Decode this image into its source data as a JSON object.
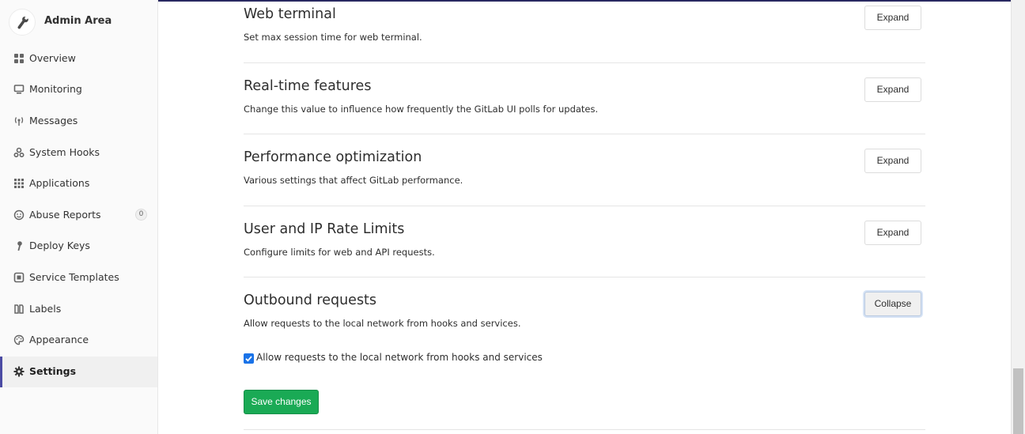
{
  "colors": {
    "accent": "#4b4ba3",
    "success": "#1aaa55",
    "topline": "#292961"
  },
  "sidebar": {
    "title": "Admin Area",
    "title_icon": "wrench-icon",
    "items": [
      {
        "label": "Overview",
        "icon": "grid-icon"
      },
      {
        "label": "Monitoring",
        "icon": "monitor-icon"
      },
      {
        "label": "Messages",
        "icon": "broadcast-icon"
      },
      {
        "label": "System Hooks",
        "icon": "hook-icon"
      },
      {
        "label": "Applications",
        "icon": "apps-grid-icon"
      },
      {
        "label": "Abuse Reports",
        "icon": "smiley-icon",
        "badge": "0"
      },
      {
        "label": "Deploy Keys",
        "icon": "key-icon"
      },
      {
        "label": "Service Templates",
        "icon": "template-icon"
      },
      {
        "label": "Labels",
        "icon": "labels-icon"
      },
      {
        "label": "Appearance",
        "icon": "palette-icon"
      },
      {
        "label": "Settings",
        "icon": "gear-icon",
        "active": true
      }
    ]
  },
  "sections": [
    {
      "title": "Web terminal",
      "description": "Set max session time for web terminal.",
      "button": "Expand"
    },
    {
      "title": "Real-time features",
      "description": "Change this value to influence how frequently the GitLab UI polls for updates.",
      "button": "Expand"
    },
    {
      "title": "Performance optimization",
      "description": "Various settings that affect GitLab performance.",
      "button": "Expand"
    },
    {
      "title": "User and IP Rate Limits",
      "description": "Configure limits for web and API requests.",
      "button": "Expand"
    },
    {
      "title": "Outbound requests",
      "description": "Allow requests to the local network from hooks and services.",
      "button": "Collapse"
    }
  ],
  "outbound": {
    "checkbox_label": "Allow requests to the local network from hooks and services",
    "checkbox_checked": true,
    "save_label": "Save changes"
  }
}
